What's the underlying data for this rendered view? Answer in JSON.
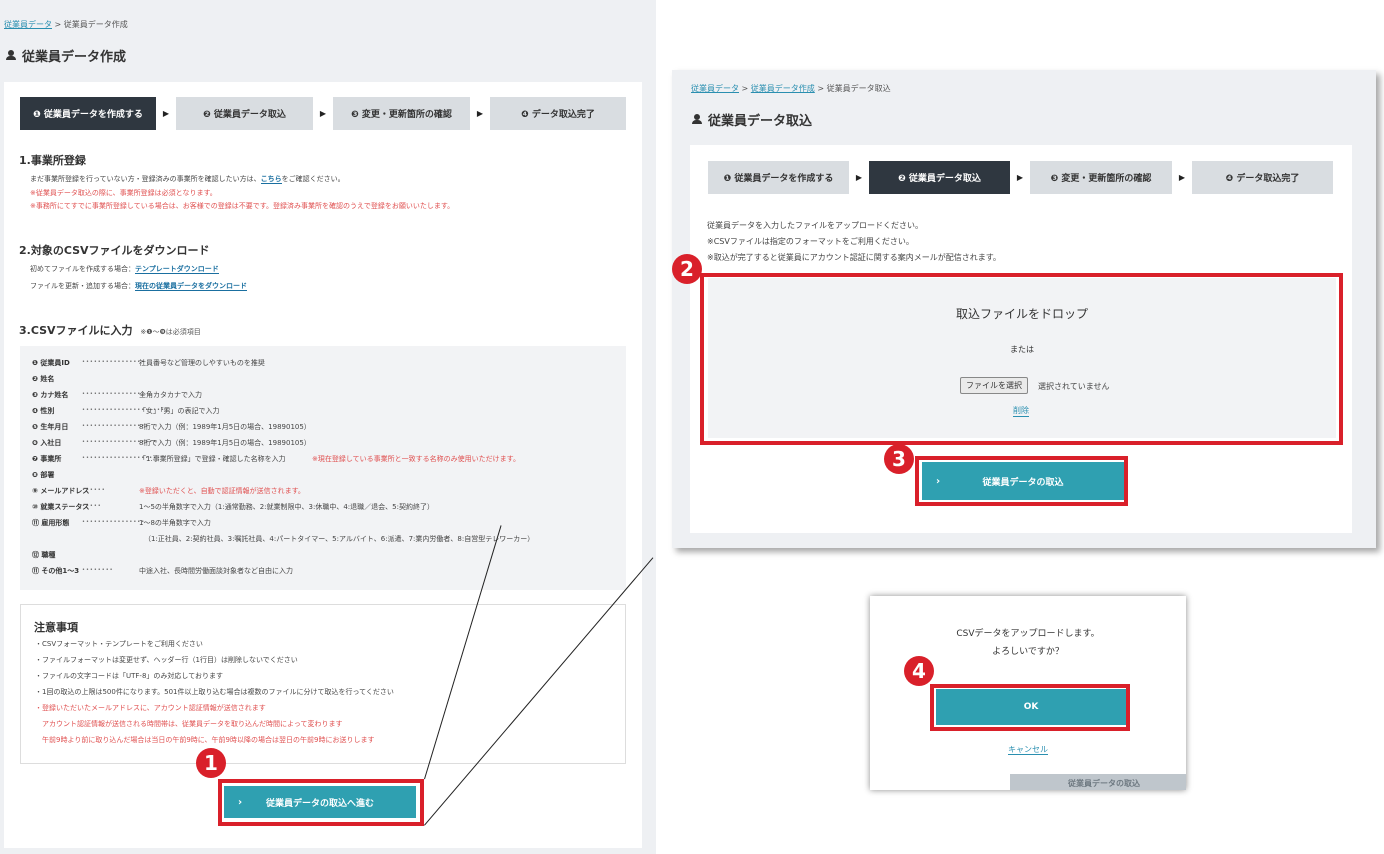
{
  "left": {
    "breadcrumb": {
      "link": "従業員データ",
      "sep": ">",
      "current": "従業員データ作成"
    },
    "title": "従業員データ作成",
    "steps": [
      "❶ 従業員データを作成する",
      "❷ 従業員データ取込",
      "❸ 変更・更新箇所の確認",
      "❹ データ取込完了"
    ],
    "section1": {
      "heading": "1.事業所登録",
      "line1_pre": "まだ事業所登録を行っていない方・登録済みの事業所を確認したい方は、",
      "line1_link": "こちら",
      "line1_post": "をご確認ください。",
      "note1": "※従業員データ取込の際に、事業所登録は必須となります。",
      "note2": "※事務所にてすでに事業所登録している場合は、お客様での登録は不要です。登録済み事業所を確認のうえで登録をお願いいたします。"
    },
    "section2": {
      "heading": "2.対象のCSVファイルをダウンロード",
      "line1_pre": "初めてファイルを作成する場合：",
      "line1_link": "テンプレートダウンロード",
      "line2_pre": "ファイルを更新・追加する場合：",
      "line2_link": "現在の従業員データをダウンロード"
    },
    "section3": {
      "heading": "3.CSVファイルに入力",
      "heading_note": "※❶〜❾は必須項目",
      "rows": [
        {
          "label": "❶ 従業員ID",
          "dots": "••••••••••••••••",
          "value": "社員番号など管理のしやすいものを推奨",
          "note": ""
        },
        {
          "label": "❷ 姓名",
          "dots": "",
          "value": "",
          "note": ""
        },
        {
          "label": "❸ カナ姓名",
          "dots": "••••••••••••••••",
          "value": "全角カタカナで入力",
          "note": ""
        },
        {
          "label": "❹ 性別",
          "dots": "••••••••••••••••••••••",
          "value": "「女」「男」の表記で入力",
          "note": ""
        },
        {
          "label": "❺ 生年月日",
          "dots": "•••••••••••••••••",
          "value": "8桁で入力（例：1989年1月5日の場合、19890105）",
          "note": ""
        },
        {
          "label": "❻ 入社日",
          "dots": "•••••••••••••••••••",
          "value": "8桁で入力（例：1989年1月5日の場合、19890105）",
          "note": ""
        },
        {
          "label": "❼ 事業所",
          "dots": "••••••••••••••••••••",
          "value": "「1.事業所登録」で登録・確認した名称を入力",
          "note": "※現在登録している事業所と一致する名称のみ使用いただけます。"
        },
        {
          "label": "❽ 部署",
          "dots": "",
          "value": "",
          "note": ""
        },
        {
          "label": "⑨ メールアドレス",
          "dots": "••••••",
          "value": "",
          "note": "※登録いただくと、自動で認証情報が送信されます。"
        },
        {
          "label": "⑩ 就業ステータス",
          "dots": "•••••",
          "value": "1〜5の半角数字で入力（1:通常勤務、2:就業制限中、3:休職中、4:退職／退会、5:契約終了）",
          "note": ""
        },
        {
          "label": "⑪ 雇用形態",
          "dots": "••••••••••••••••",
          "value": "1〜8の半角数字で入力",
          "note": ""
        },
        {
          "label": "",
          "dots": "",
          "value": "（1:正社員、2:契約社員、3:嘱託社員、4:パートタイマー、5:アルバイト、6:派遣、7:業内労働者、8:自営型テレワーカー）",
          "note": ""
        },
        {
          "label": "⑫ 職種",
          "dots": "",
          "value": "",
          "note": ""
        },
        {
          "label": "⑪ その他1〜3",
          "dots": "••••••••",
          "value": "中途入社、長時間労働面談対象者など自由に入力",
          "note": ""
        }
      ]
    },
    "notes": {
      "heading": "注意事項",
      "items": [
        {
          "text": "・CSVフォーマット・テンプレートをご利用ください",
          "red": false
        },
        {
          "text": "・ファイルフォーマットは変更せず、ヘッダー行（1行目）は削除しないでください",
          "red": false
        },
        {
          "text": "・ファイルの文字コードは「UTF-8」のみ対応しております",
          "red": false
        },
        {
          "text": "・1回の取込の上限は500件になります。501件以上取り込む場合は複数のファイルに分けて取込を行ってください",
          "red": false
        },
        {
          "text": "・登録いただいたメールアドレスに、アカウント認証情報が送信されます",
          "red": true
        },
        {
          "text": "　アカウント認証情報が送信される時間帯は、従業員データを取り込んだ時間によって変わります",
          "red": true
        },
        {
          "text": "　午前9時より前に取り込んだ場合は当日の午前9時に、午前9時以降の場合は翌日の午前9時にお送りします",
          "red": true
        }
      ]
    },
    "proceed_button": "従業員データの取込へ進む"
  },
  "right": {
    "breadcrumb": {
      "link1": "従業員データ",
      "link2": "従業員データ作成",
      "current": "従業員データ取込",
      "sep": ">"
    },
    "title": "従業員データ取込",
    "steps": [
      "❶ 従業員データを作成する",
      "❷ 従業員データ取込",
      "❸ 変更・更新箇所の確認",
      "❹ データ取込完了"
    ],
    "desc": [
      "従業員データを入力したファイルをアップロードください。",
      "※CSVファイルは指定のフォーマットをご利用ください。",
      "※取込が完了すると従業員にアカウント認証に関する案内メールが配信されます。"
    ],
    "drop_title": "取込ファイルをドロップ",
    "or": "または",
    "file_button": "ファイルを選択",
    "file_status": "選択されていません",
    "delete": "削除",
    "import_button": "従業員データの取込"
  },
  "dialog": {
    "line1": "CSVデータをアップロードします。",
    "line2": "よろしいですか？",
    "ok": "OK",
    "cancel": "キャンセル",
    "behind_text": "従業員データの取込"
  },
  "markers": [
    "1",
    "2",
    "3",
    "4"
  ],
  "colors": {
    "accent": "#2fa0b1",
    "highlight": "#d9202a",
    "active_step": "#2f3740"
  }
}
